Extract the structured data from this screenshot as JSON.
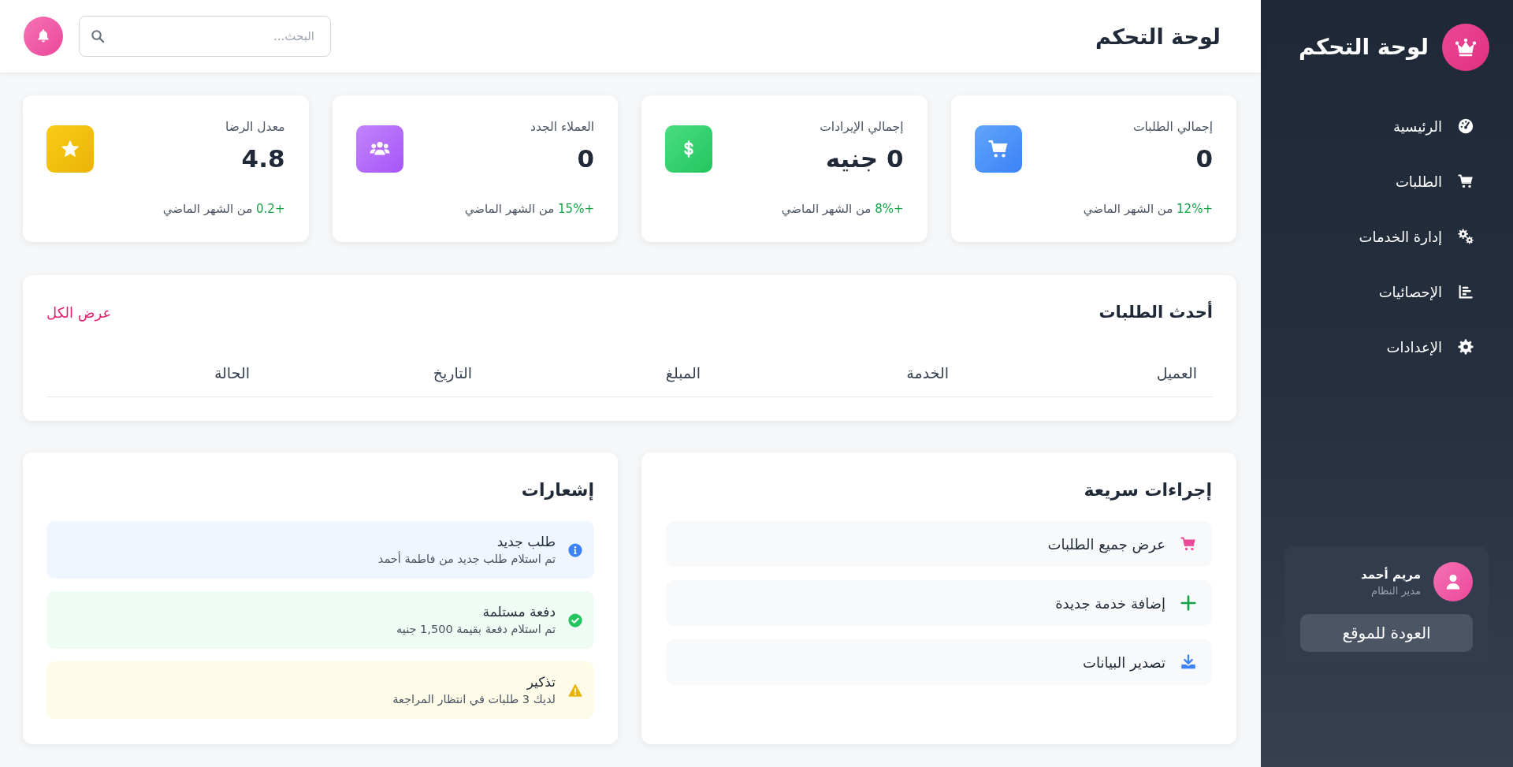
{
  "sidebar": {
    "title": "لوحة التحكم",
    "items": [
      {
        "kind": "home",
        "label": "الرئيسية",
        "selected": false
      },
      {
        "kind": "orders",
        "label": "الطلبات",
        "selected": false
      },
      {
        "kind": "services",
        "label": "إدارة الخدمات",
        "selected": false
      },
      {
        "kind": "stats",
        "label": "الإحصائيات",
        "selected": false
      },
      {
        "kind": "settings",
        "label": "الإعدادات",
        "selected": false
      }
    ],
    "user": {
      "name": "مريم أحمد",
      "role": "مدير النظام"
    },
    "back_button": "العودة للموقع"
  },
  "header": {
    "title": "لوحة التحكم",
    "search": {
      "placeholder": "البحث..."
    }
  },
  "stats": [
    {
      "kind": "orders",
      "title": "إجمالي الطلبات",
      "value": "0",
      "change": "+12%",
      "note": "من الشهر الماضي"
    },
    {
      "kind": "revenue",
      "title": "إجمالي الإيرادات",
      "value": "0 جنيه",
      "change": "+8%",
      "note": "من الشهر الماضي"
    },
    {
      "kind": "customers",
      "title": "العملاء الجدد",
      "value": "0",
      "change": "+15%",
      "note": "من الشهر الماضي"
    },
    {
      "kind": "rating",
      "title": "معدل الرضا",
      "value": "4.8",
      "change": "+0.2",
      "note": "من الشهر الماضي"
    }
  ],
  "recent_orders": {
    "title": "أحدث الطلبات",
    "link": "عرض الكل",
    "columns": [
      "العميل",
      "الخدمة",
      "المبلغ",
      "التاريخ",
      "الحالة"
    ]
  },
  "quick_actions": {
    "title": "إجراءات سريعة",
    "items": [
      {
        "kind": "orders",
        "label": "عرض جميع الطلبات"
      },
      {
        "kind": "add",
        "label": "إضافة خدمة جديدة"
      },
      {
        "kind": "export",
        "label": "تصدير البيانات"
      }
    ]
  },
  "notifications": {
    "title": "إشعارات",
    "items": [
      {
        "kind": "info",
        "title": "طلب جديد",
        "text": "تم استلام طلب جديد من فاطمة أحمد"
      },
      {
        "kind": "success",
        "title": "دفعة مستلمة",
        "text": "تم استلام دفعة بقيمة 1,500 جنيه"
      },
      {
        "kind": "warning",
        "title": "تذكير",
        "text": "لديك 3 طلبات في انتظار المراجعة"
      }
    ]
  }
}
